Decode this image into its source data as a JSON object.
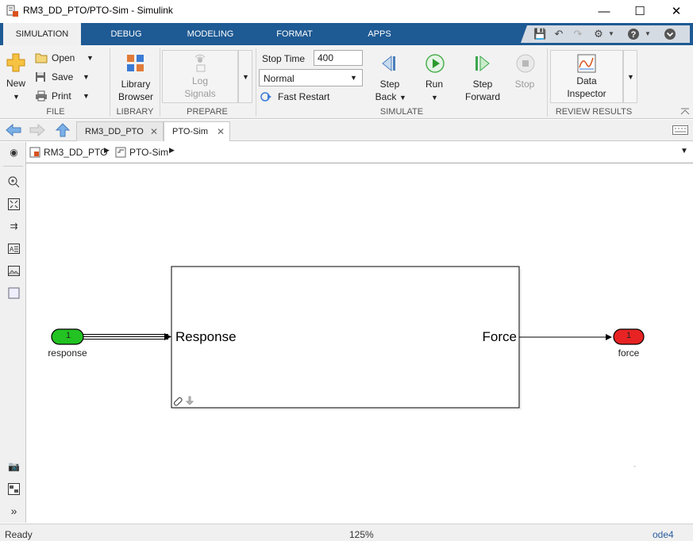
{
  "window": {
    "title": "RM3_DD_PTO/PTO-Sim - Simulink"
  },
  "ribbon_tabs": [
    "SIMULATION",
    "DEBUG",
    "MODELING",
    "FORMAT",
    "APPS"
  ],
  "ribbon": {
    "file": {
      "new_label": "New",
      "open_label": "Open",
      "save_label": "Save",
      "print_label": "Print",
      "section": "FILE"
    },
    "library": {
      "browser_line1": "Library",
      "browser_line2": "Browser",
      "section": "LIBRARY"
    },
    "prepare": {
      "log_line1": "Log",
      "log_line2": "Signals",
      "section": "PREPARE"
    },
    "simulate": {
      "stop_time_label": "Stop Time",
      "stop_time_value": "400",
      "mode_value": "Normal",
      "fast_restart_label": "Fast Restart",
      "step_back_line1": "Step",
      "step_back_line2": "Back",
      "run_label": "Run",
      "step_forward_line1": "Step",
      "step_forward_line2": "Forward",
      "stop_label": "Stop",
      "section": "SIMULATE"
    },
    "review": {
      "data_inspector_line1": "Data",
      "data_inspector_line2": "Inspector",
      "section": "REVIEW RESULTS"
    }
  },
  "model_tabs": [
    {
      "label": "RM3_DD_PTO"
    },
    {
      "label": "PTO-Sim"
    }
  ],
  "breadcrumb": [
    "RM3_DD_PTO",
    "PTO-Sim"
  ],
  "diagram": {
    "inport": {
      "number": "1",
      "name": "response"
    },
    "outport": {
      "number": "1",
      "name": "force"
    },
    "subsystem": {
      "input_label": "Response",
      "output_label": "Force"
    }
  },
  "status": {
    "state": "Ready",
    "zoom": "125%",
    "solver": "ode4"
  },
  "colors": {
    "tab_bar": "#1e5a94",
    "inport_fill": "#22c322",
    "outport_fill": "#e82323"
  }
}
